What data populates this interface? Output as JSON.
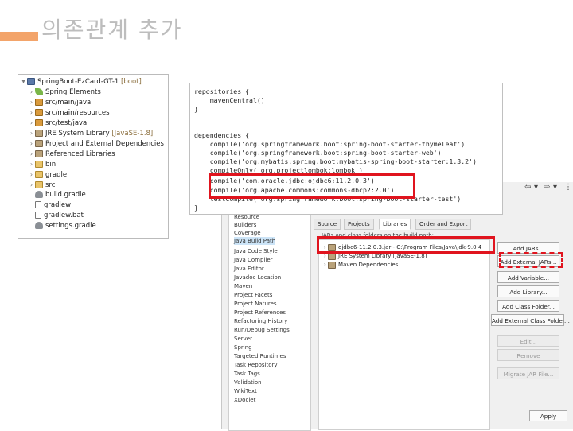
{
  "slide": {
    "title": "의존관계 추가"
  },
  "project_tree": {
    "root_label": "SpringBoot-EzCard-GT-1",
    "root_tag": "[boot]",
    "items": [
      {
        "label": "Spring Elements",
        "icon": "leaf-icon"
      },
      {
        "label": "src/main/java",
        "icon": "package-folder-icon"
      },
      {
        "label": "src/main/resources",
        "icon": "package-folder-icon"
      },
      {
        "label": "src/test/java",
        "icon": "package-folder-icon"
      },
      {
        "label": "JRE System Library",
        "tag": "[JavaSE-1.8]",
        "icon": "library-icon"
      },
      {
        "label": "Project and External Dependencies",
        "icon": "library-icon"
      },
      {
        "label": "Referenced Libraries",
        "icon": "library-icon"
      },
      {
        "label": "bin",
        "icon": "folder-icon"
      },
      {
        "label": "gradle",
        "icon": "folder-icon"
      },
      {
        "label": "src",
        "icon": "folder-icon"
      },
      {
        "label": "build.gradle",
        "icon": "gradle-file-icon"
      },
      {
        "label": "gradlew",
        "icon": "file-icon"
      },
      {
        "label": "gradlew.bat",
        "icon": "file-icon"
      },
      {
        "label": "settings.gradle",
        "icon": "gradle-file-icon"
      }
    ]
  },
  "code": {
    "lines": [
      "repositories {",
      "    mavenCentral()",
      "}",
      "",
      "dependencies {",
      "    compile('org.springframework.boot:spring-boot-starter-thymeleaf')",
      "    compile('org.springframework.boot:spring-boot-starter-web')",
      "    compile('org.mybatis.spring.boot:mybatis-spring-boot-starter:1.3.2')",
      "    compileOnly('org.projectlombok:lombok')",
      "    compile('com.oracle.jdbc:ojdbc6:11.2.0.3')",
      "    compile('org.apache.commons:commons-dbcp2:2.0')",
      "    testCompile('org.springframework.boot:spring-boot-starter-test')",
      "}"
    ]
  },
  "dialog": {
    "categories": [
      "Resource",
      "Builders",
      "Coverage",
      "Java Build Path",
      "Java Code Style",
      "Java Compiler",
      "Java Editor",
      "Javadoc Location",
      "Maven",
      "Project Facets",
      "Project Natures",
      "Project References",
      "Refactoring History",
      "Run/Debug Settings",
      "Server",
      "Spring",
      "Targeted Runtimes",
      "Task Repository",
      "Task Tags",
      "Validation",
      "WikiText",
      "XDoclet"
    ],
    "selected_category": "Java Build Path",
    "tabs": [
      "Source",
      "Projects",
      "Libraries",
      "Order and Export"
    ],
    "active_tab": "Libraries",
    "libraries_hint": "JARs and class folders on the build path:",
    "libraries": [
      "ojdbc6-11.2.0.3.jar - C:\\Program Files\\Java\\jdk-9.0.4",
      "JRE System Library [JavaSE-1.8]",
      "Maven Dependencies"
    ],
    "buttons": [
      {
        "label": "Add JARs...",
        "enabled": true
      },
      {
        "label": "Add External JARs...",
        "enabled": true
      },
      {
        "label": "Add Variable...",
        "enabled": true
      },
      {
        "label": "Add Library...",
        "enabled": true
      },
      {
        "label": "Add Class Folder...",
        "enabled": true
      },
      {
        "label": "Add External Class Folder...",
        "enabled": true
      },
      {
        "label": "Edit...",
        "enabled": false
      },
      {
        "label": "Remove",
        "enabled": false
      },
      {
        "label": "Migrate JAR File...",
        "enabled": false
      }
    ],
    "apply_label": "Apply"
  },
  "colors": {
    "accent": "#f3a46a",
    "highlight": "#e0141e"
  }
}
